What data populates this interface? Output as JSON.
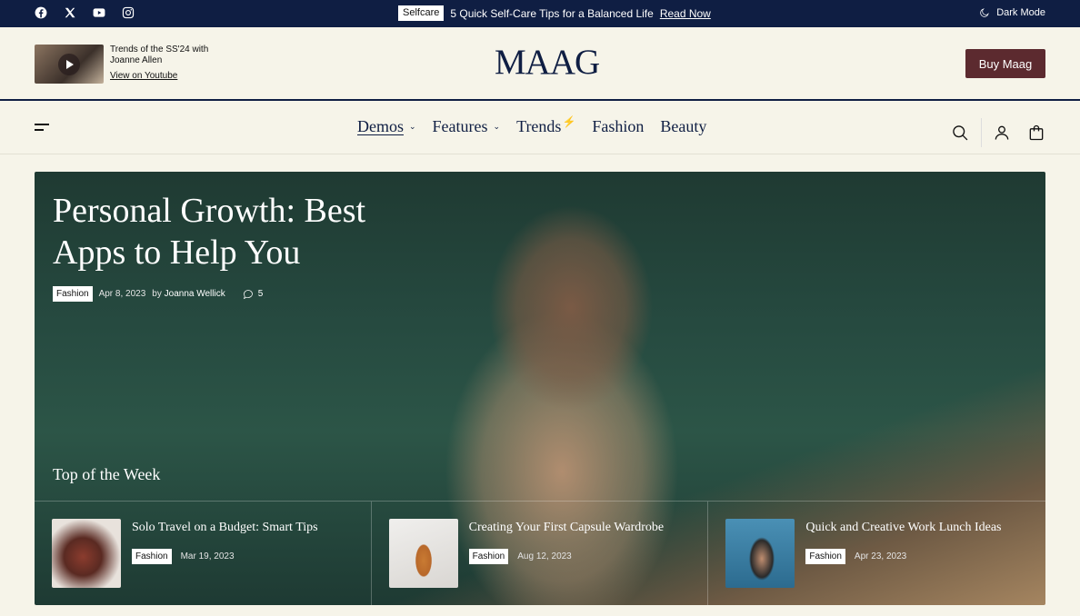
{
  "topbar": {
    "socials": [
      "facebook-icon",
      "x-icon",
      "youtube-icon",
      "instagram-icon"
    ],
    "ticker_tag": "Selfcare",
    "ticker_text": "5 Quick Self-Care Tips for a Balanced Life",
    "ticker_link": "Read Now",
    "dark_mode_label": "Dark Mode",
    "background_color": "#0f1e43"
  },
  "header": {
    "video_title": "Trends of the SS'24 with Joanne Allen",
    "video_link": "View on Youtube",
    "logo": "MAAG",
    "buy_button": "Buy Maag",
    "buy_button_color": "#5c2a2f"
  },
  "nav": {
    "items": [
      {
        "label": "Demos",
        "dropdown": true,
        "active": true
      },
      {
        "label": "Features",
        "dropdown": true
      },
      {
        "label": "Trends",
        "badge": "bolt-icon"
      },
      {
        "label": "Fashion"
      },
      {
        "label": "Beauty"
      }
    ],
    "icons": [
      "search-icon",
      "user-icon",
      "shopping-bag-icon"
    ]
  },
  "hero": {
    "title": "Personal Growth: Best Apps to Help You",
    "category": "Fashion",
    "date": "Apr 8, 2023",
    "by": "by",
    "author": "Joanna Wellick",
    "comments": "5",
    "section_title": "Top of the Week",
    "cards": [
      {
        "title": "Solo Travel on a Budget: Smart Tips",
        "category": "Fashion",
        "date": "Mar 19, 2023"
      },
      {
        "title": "Creating Your First Capsule Wardrobe",
        "category": "Fashion",
        "date": "Aug 12, 2023"
      },
      {
        "title": "Quick and Creative Work Lunch Ideas",
        "category": "Fashion",
        "date": "Apr 23, 2023"
      }
    ]
  }
}
